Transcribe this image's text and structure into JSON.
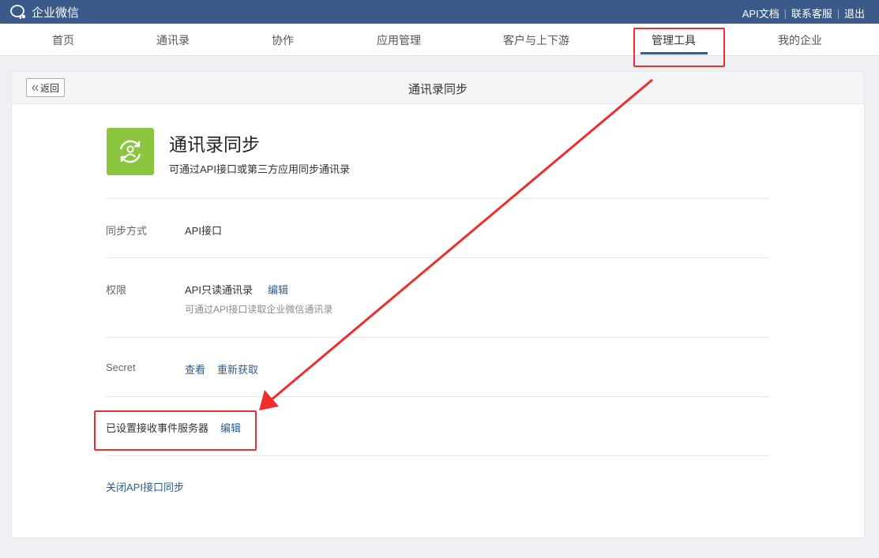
{
  "topbar": {
    "brand": "企业微信",
    "links": [
      "API文档",
      "联系客服",
      "退出"
    ],
    "separator": "|"
  },
  "nav": {
    "items": [
      "首页",
      "通讯录",
      "协作",
      "应用管理",
      "客户与上下游",
      "管理工具",
      "我的企业"
    ],
    "active": "管理工具"
  },
  "panel": {
    "back_label": "返回",
    "title": "通讯录同步"
  },
  "app": {
    "icon": "contacts-sync-icon",
    "icon_color": "#8cc63f",
    "name": "通讯录同步",
    "description": "可通过API接口或第三方应用同步通讯录"
  },
  "rows": {
    "sync_method": {
      "label": "同步方式",
      "value": "API接口"
    },
    "permission": {
      "label": "权限",
      "value": "API只读通讯录",
      "edit": "编辑",
      "hint": "可通过API接口读取企业微信通讯录"
    },
    "secret": {
      "label": "Secret",
      "view": "查看",
      "refresh": "重新获取"
    },
    "event_server": {
      "text": "已设置接收事件服务器",
      "edit": "编辑"
    },
    "close_link": "关闭API接口同步"
  },
  "colors": {
    "topbar": "#3a5a8a",
    "link": "#2e5c8a",
    "annotation": "#ee2d2d"
  }
}
